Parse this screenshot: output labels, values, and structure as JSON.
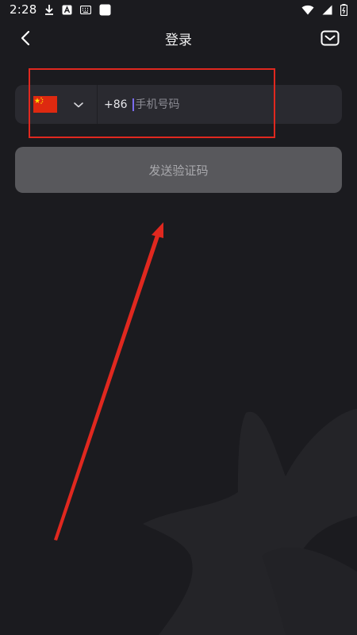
{
  "status_bar": {
    "time": "2:28",
    "icons": [
      "download-icon",
      "a-badge-icon",
      "keyboard-icon",
      "square-app-icon",
      "wifi-icon",
      "signal-icon",
      "battery-icon"
    ]
  },
  "header": {
    "title": "登录",
    "back_icon": "chevron-left-icon",
    "mail_icon": "mail-icon"
  },
  "phone_form": {
    "country_flag": "china-flag-icon",
    "country_dropdown_icon": "chevron-down-icon",
    "dial_code": "+86",
    "phone_placeholder": "手机号码",
    "phone_value": ""
  },
  "send_code": {
    "label": "发送验证码"
  },
  "annotation": {
    "highlight_color": "#e0281f",
    "arrow_color": "#e0281f"
  },
  "colors": {
    "background": "#1b1b1f",
    "input_bg": "#2a2a30",
    "button_bg": "#58585c",
    "cursor": "#7b6cf0"
  }
}
